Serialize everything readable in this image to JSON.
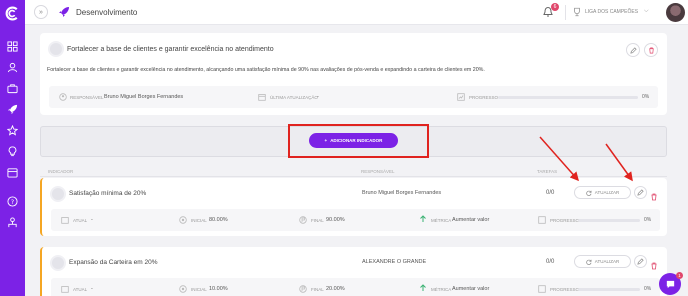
{
  "topbar": {
    "title": "Desenvolvimento",
    "collapse_glyph": "»",
    "notifications_count": "6",
    "league": "LIGA DOS CAMPEÕES",
    "chevron": "⌵"
  },
  "goal": {
    "title": "Fortalecer a base de clientes e garantir excelência no atendimento",
    "description": "Fortalecer a base de clientes e garantir excelência no atendimento, alcançando uma satisfação mínima de 90% nas avaliações de pós-venda e expandindo a carteira de clientes em 20%.",
    "responsible_label": "RESPONSÁVEL",
    "responsible": "Bruno Miguel Borges Fernandes",
    "last_update_label": "ÚLTIMA ATUALIZAÇÃO",
    "last_update": "-",
    "progress_label": "PROGRESSO",
    "progress": 0,
    "progress_text": "0%"
  },
  "add_indicator_label": "ADICIONAR INDICADOR",
  "table_headers": {
    "indicator": "INDICADOR",
    "responsible": "RESPONSÁVEL",
    "tasks": "TAREFAS"
  },
  "indicators": [
    {
      "title": "Satisfação mínima de 20%",
      "responsible": "Bruno Miguel Borges Fernandes",
      "tasks": "0/0",
      "update_label": "ATUALIZAR",
      "current_label": "ATUAL",
      "current": "-",
      "initial_label": "INICIAL",
      "initial": "80.00%",
      "final_label": "FINAL",
      "final": "90.00%",
      "metric_label": "MÉTRICA",
      "metric": "Aumentar valor",
      "progress_label": "PROGRESSO",
      "progress": 0,
      "progress_text": "0%"
    },
    {
      "title": "Expansão da Carteira em 20%",
      "responsible": "ALEXANDRE O GRANDE",
      "tasks": "0/0",
      "update_label": "ATUALIZAR",
      "current_label": "ATUAL",
      "current": "-",
      "initial_label": "INICIAL",
      "initial": "10.00%",
      "final_label": "FINAL",
      "final": "20.00%",
      "metric_label": "MÉTRICA",
      "metric": "Aumentar valor",
      "progress_label": "PROGRESSO",
      "progress": 0,
      "progress_text": "0%"
    }
  ],
  "chat_badge": "1",
  "colors": {
    "accent": "#7c22e6",
    "highlight": "#e0231f",
    "delete": "#e0476b",
    "row_accent": "#f5a623"
  },
  "icons": [
    "logo-icon",
    "grid-icon",
    "user-icon",
    "briefcase-icon",
    "rocket-icon",
    "star-icon",
    "bulb-icon",
    "calendar-icon",
    "help-icon",
    "team-icon",
    "bell-icon",
    "trophy-icon",
    "edit-icon",
    "trash-icon",
    "chat-icon"
  ]
}
